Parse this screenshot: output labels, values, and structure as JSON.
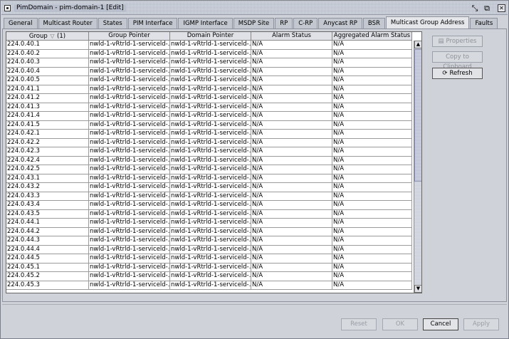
{
  "window": {
    "title": "PimDomain - pim-domain-1 [Edit]",
    "controls": {
      "resize": "▫",
      "dock": "▫",
      "close": "✕"
    }
  },
  "tabs": [
    {
      "label": "General",
      "active": false
    },
    {
      "label": "Multicast Router",
      "active": false
    },
    {
      "label": "States",
      "active": false
    },
    {
      "label": "PIM Interface",
      "active": false
    },
    {
      "label": "IGMP Interface",
      "active": false
    },
    {
      "label": "MSDP Site",
      "active": false
    },
    {
      "label": "RP",
      "active": false
    },
    {
      "label": "C-RP",
      "active": false
    },
    {
      "label": "Anycast RP",
      "active": false
    },
    {
      "label": "BSR",
      "active": false
    },
    {
      "label": "Multicast Group Address",
      "active": true
    },
    {
      "label": "Faults",
      "active": false
    }
  ],
  "table": {
    "columns": [
      "Group",
      "Group Pointer",
      "Domain Pointer",
      "Alarm Status",
      "Aggregated Alarm Status"
    ],
    "group_sort_suffix": "(1)",
    "pointer_text": "nwld-1-vRtrld-1-serviceld-...",
    "rows": [
      [
        "224.0.40.1",
        "N/A",
        "N/A"
      ],
      [
        "224.0.40.2",
        "N/A",
        "N/A"
      ],
      [
        "224.0.40.3",
        "N/A",
        "N/A"
      ],
      [
        "224.0.40.4",
        "N/A",
        "N/A"
      ],
      [
        "224.0.40.5",
        "N/A",
        "N/A"
      ],
      [
        "224.0.41.1",
        "N/A",
        "N/A"
      ],
      [
        "224.0.41.2",
        "N/A",
        "N/A"
      ],
      [
        "224.0.41.3",
        "N/A",
        "N/A"
      ],
      [
        "224.0.41.4",
        "N/A",
        "N/A"
      ],
      [
        "224.0.41.5",
        "N/A",
        "N/A"
      ],
      [
        "224.0.42.1",
        "N/A",
        "N/A"
      ],
      [
        "224.0.42.2",
        "N/A",
        "N/A"
      ],
      [
        "224.0.42.3",
        "N/A",
        "N/A"
      ],
      [
        "224.0.42.4",
        "N/A",
        "N/A"
      ],
      [
        "224.0.42.5",
        "N/A",
        "N/A"
      ],
      [
        "224.0.43.1",
        "N/A",
        "N/A"
      ],
      [
        "224.0.43.2",
        "N/A",
        "N/A"
      ],
      [
        "224.0.43.3",
        "N/A",
        "N/A"
      ],
      [
        "224.0.43.4",
        "N/A",
        "N/A"
      ],
      [
        "224.0.43.5",
        "N/A",
        "N/A"
      ],
      [
        "224.0.44.1",
        "N/A",
        "N/A"
      ],
      [
        "224.0.44.2",
        "N/A",
        "N/A"
      ],
      [
        "224.0.44.3",
        "N/A",
        "N/A"
      ],
      [
        "224.0.44.4",
        "N/A",
        "N/A"
      ],
      [
        "224.0.44.5",
        "N/A",
        "N/A"
      ],
      [
        "224.0.45.1",
        "N/A",
        "N/A"
      ],
      [
        "224.0.45.2",
        "N/A",
        "N/A"
      ],
      [
        "224.0.45.3",
        "N/A",
        "N/A"
      ]
    ]
  },
  "side_buttons": {
    "properties": "Properties",
    "copy": "Copy to Clipboard",
    "refresh": "Refresh"
  },
  "footer_buttons": {
    "reset": "Reset",
    "ok": "OK",
    "cancel": "Cancel",
    "apply": "Apply"
  }
}
